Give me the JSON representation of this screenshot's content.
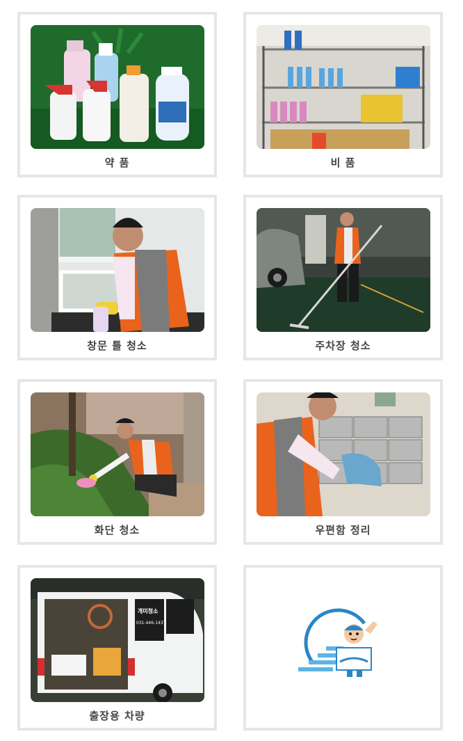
{
  "gallery": [
    {
      "caption": "약 품"
    },
    {
      "caption": "비 품"
    },
    {
      "caption": "창문 틀 청소"
    },
    {
      "caption": "주차장 청소"
    },
    {
      "caption": "화단 청소"
    },
    {
      "caption": "우편함 정리"
    },
    {
      "caption": "출장용 차량"
    }
  ],
  "van": {
    "phone": "031-446-1437"
  },
  "colors": {
    "frame": "#e6e6e6",
    "caption": "#444444",
    "vest": "#e9631c",
    "logo_blue": "#2a86c8"
  }
}
